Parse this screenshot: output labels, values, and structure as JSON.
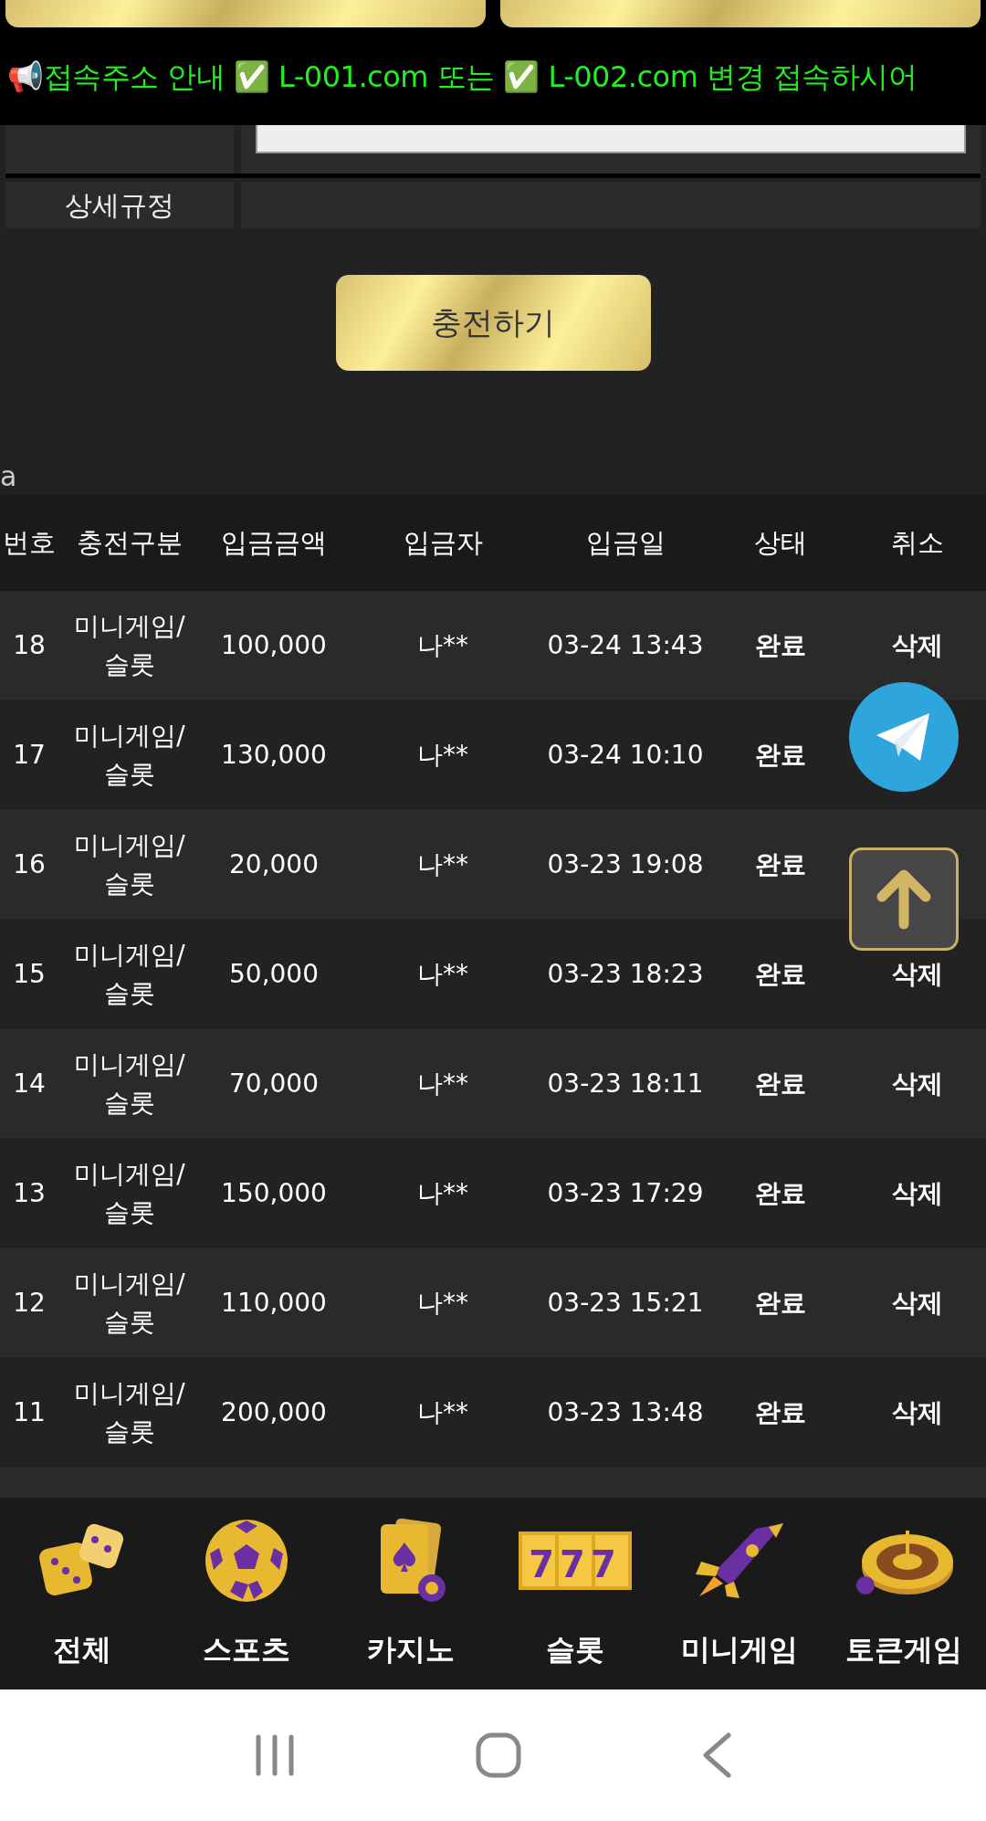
{
  "notice": {
    "text": "📢접속주소 안내 ✅ L-001.com 또는 ✅ L-002.com 변경 접속하시어"
  },
  "form": {
    "rows": [
      {
        "label": "상세규정"
      }
    ]
  },
  "submit_button": "충전하기",
  "section_label": "a",
  "table": {
    "columns": [
      "번호",
      "충전구분",
      "입금금액",
      "입금자",
      "입금일",
      "상태",
      "취소"
    ],
    "rows": [
      {
        "no": "18",
        "type": "미니게임/슬롯",
        "amount": "100,000",
        "depositor": "나**",
        "date": "03-24 13:43",
        "status": "완료",
        "cancel": "삭제"
      },
      {
        "no": "17",
        "type": "미니게임/슬롯",
        "amount": "130,000",
        "depositor": "나**",
        "date": "03-24 10:10",
        "status": "완료"
      },
      {
        "no": "16",
        "type": "미니게임/슬롯",
        "amount": "20,000",
        "depositor": "나**",
        "date": "03-23 19:08",
        "status": "완료"
      },
      {
        "no": "15",
        "type": "미니게임/슬롯",
        "amount": "50,000",
        "depositor": "나**",
        "date": "03-23 18:23",
        "status": "완료",
        "cancel": "삭제"
      },
      {
        "no": "14",
        "type": "미니게임/슬롯",
        "amount": "70,000",
        "depositor": "나**",
        "date": "03-23 18:11",
        "status": "완료",
        "cancel": "삭제"
      },
      {
        "no": "13",
        "type": "미니게임/슬롯",
        "amount": "150,000",
        "depositor": "나**",
        "date": "03-23 17:29",
        "status": "완료",
        "cancel": "삭제"
      },
      {
        "no": "12",
        "type": "미니게임/슬롯",
        "amount": "110,000",
        "depositor": "나**",
        "date": "03-23 15:21",
        "status": "완료",
        "cancel": "삭제"
      },
      {
        "no": "11",
        "type": "미니게임/슬롯",
        "amount": "200,000",
        "depositor": "나**",
        "date": "03-23 13:48",
        "status": "완료",
        "cancel": "삭제"
      }
    ]
  },
  "bottom_nav": [
    {
      "label": "전체",
      "kind": "dice"
    },
    {
      "label": "스포츠",
      "kind": "ball"
    },
    {
      "label": "카지노",
      "kind": "cards"
    },
    {
      "label": "슬롯",
      "kind": "slot",
      "glyph": "777"
    },
    {
      "label": "미니게임",
      "kind": "rocket"
    },
    {
      "label": "토큰게임",
      "kind": "roulette"
    }
  ]
}
